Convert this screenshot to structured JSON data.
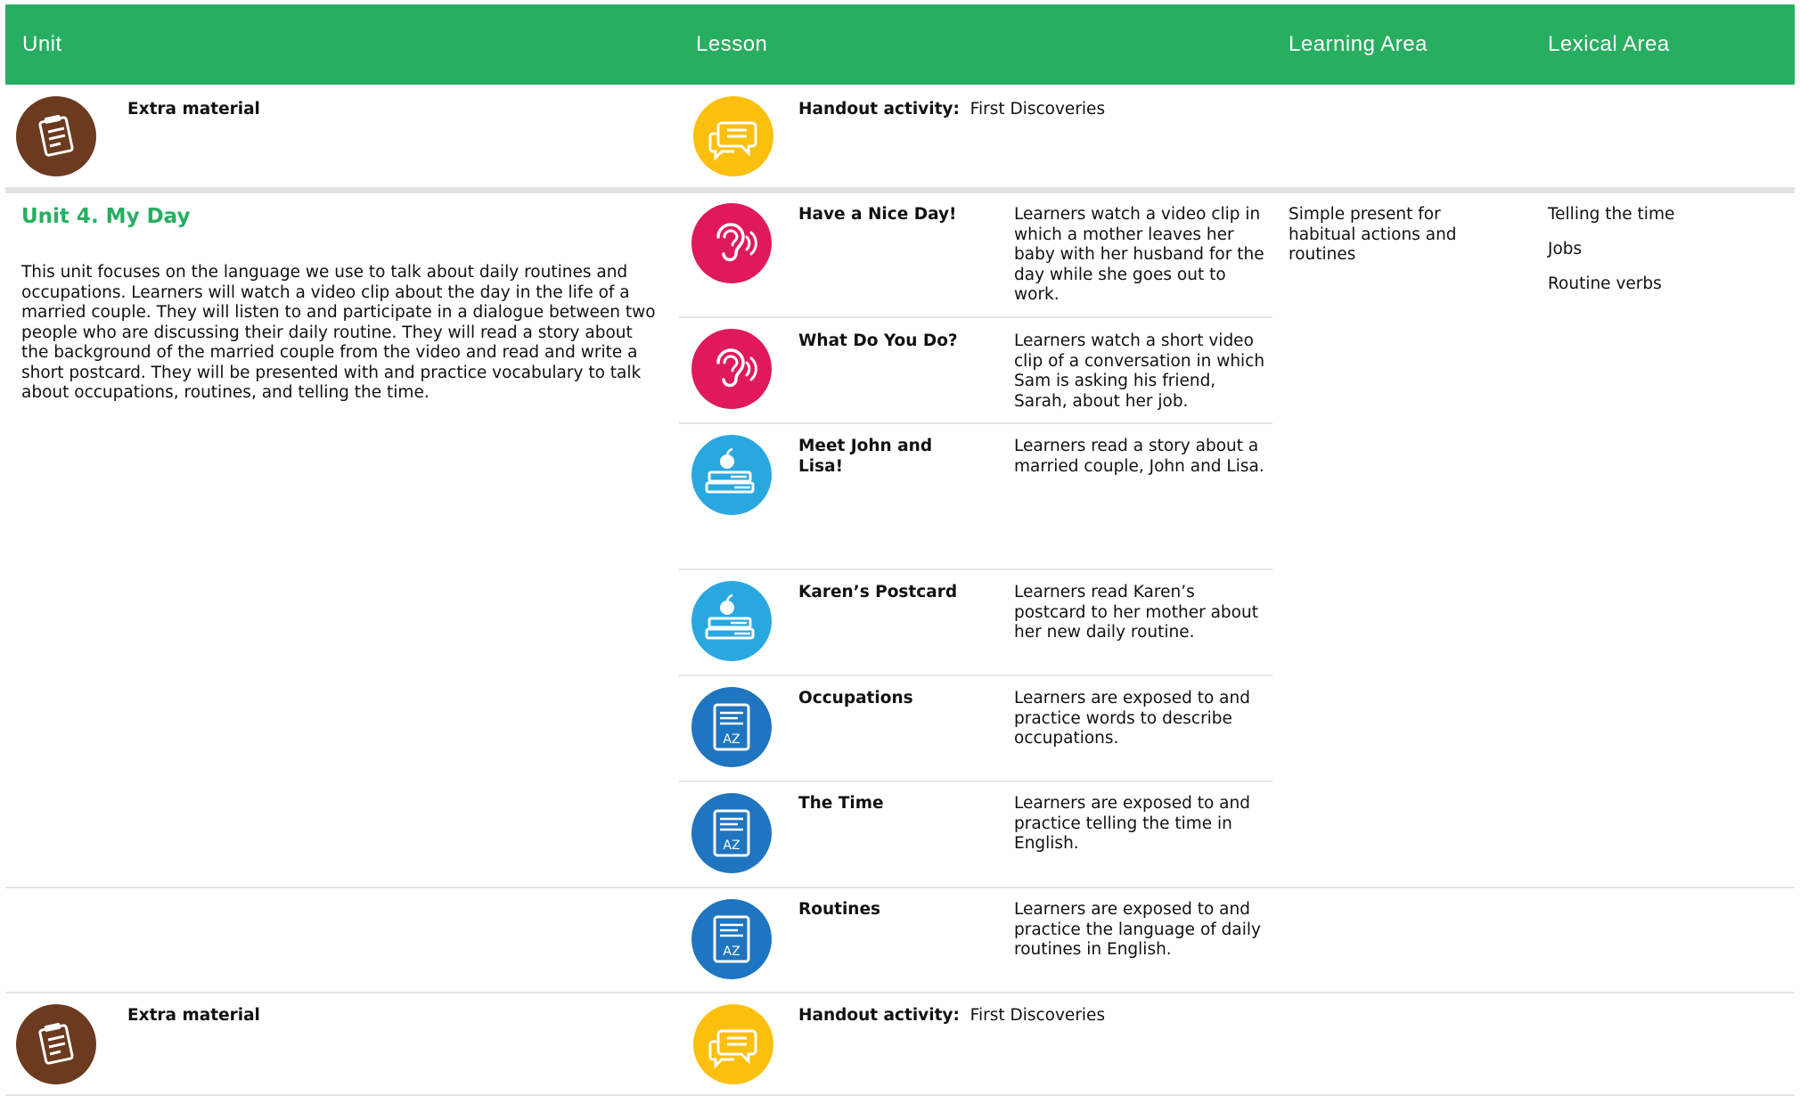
{
  "header": {
    "unit": "Unit",
    "lesson": "Lesson",
    "learning_area": "Learning Area",
    "lexical_area": "Lexical Area"
  },
  "top_extra": {
    "label": "Extra material",
    "handout_label": "Handout activity:",
    "handout_title": "First Discoveries"
  },
  "unit": {
    "title": "Unit 4. My Day",
    "description": "This unit focuses on the language we use to talk about daily routines and occupations. Learners will watch a video clip about the day in the life of a married couple. They will listen to and participate in a dialogue between two people who are discussing their daily routine. They will read a story about the background of the married couple from the video and read and write a short postcard. They will be presented with and practice vocabulary to talk about occupations, routines, and telling the time.",
    "learning_area": "Simple present for habitual actions and routines",
    "lexical_area": [
      "Telling the time",
      "Jobs",
      "Routine verbs"
    ]
  },
  "lessons": [
    {
      "icon": "ear-icon",
      "title": "Have a Nice Day!",
      "description": "Learners watch a video clip in which a mother leaves her baby with her husband for the day while she goes out to work."
    },
    {
      "icon": "ear-icon",
      "title": "What Do You Do?",
      "description": "Learners watch a short video clip of a conversation in which Sam is asking his friend, Sarah, about her job."
    },
    {
      "icon": "books-apple-icon",
      "title": "Meet John and Lisa!",
      "description": "Learners read a story about a married couple, John and Lisa."
    },
    {
      "icon": "books-apple-icon",
      "title": "Karen’s Postcard",
      "description": "Learners read Karen’s postcard to her mother about her new daily routine."
    },
    {
      "icon": "dictionary-icon",
      "title": "Occupations",
      "description": "Learners are exposed to and practice words to describe occupations."
    },
    {
      "icon": "dictionary-icon",
      "title": "The Time",
      "description": "Learners are exposed to and practice telling the time in English."
    },
    {
      "icon": "dictionary-icon",
      "title": "Routines",
      "description": "Learners are exposed to and practice the language of daily routines in English."
    }
  ],
  "bottom_extra": {
    "label": "Extra material",
    "handout_label": "Handout activity:",
    "handout_title": "First Discoveries"
  },
  "colors": {
    "header_green": "#27ae60",
    "extra_brown": "#6b3a1f",
    "handout_yellow": "#fbbf0e",
    "listening_pink": "#e0195c",
    "reading_cyan": "#29a8e0",
    "vocab_blue": "#1f75bf"
  }
}
